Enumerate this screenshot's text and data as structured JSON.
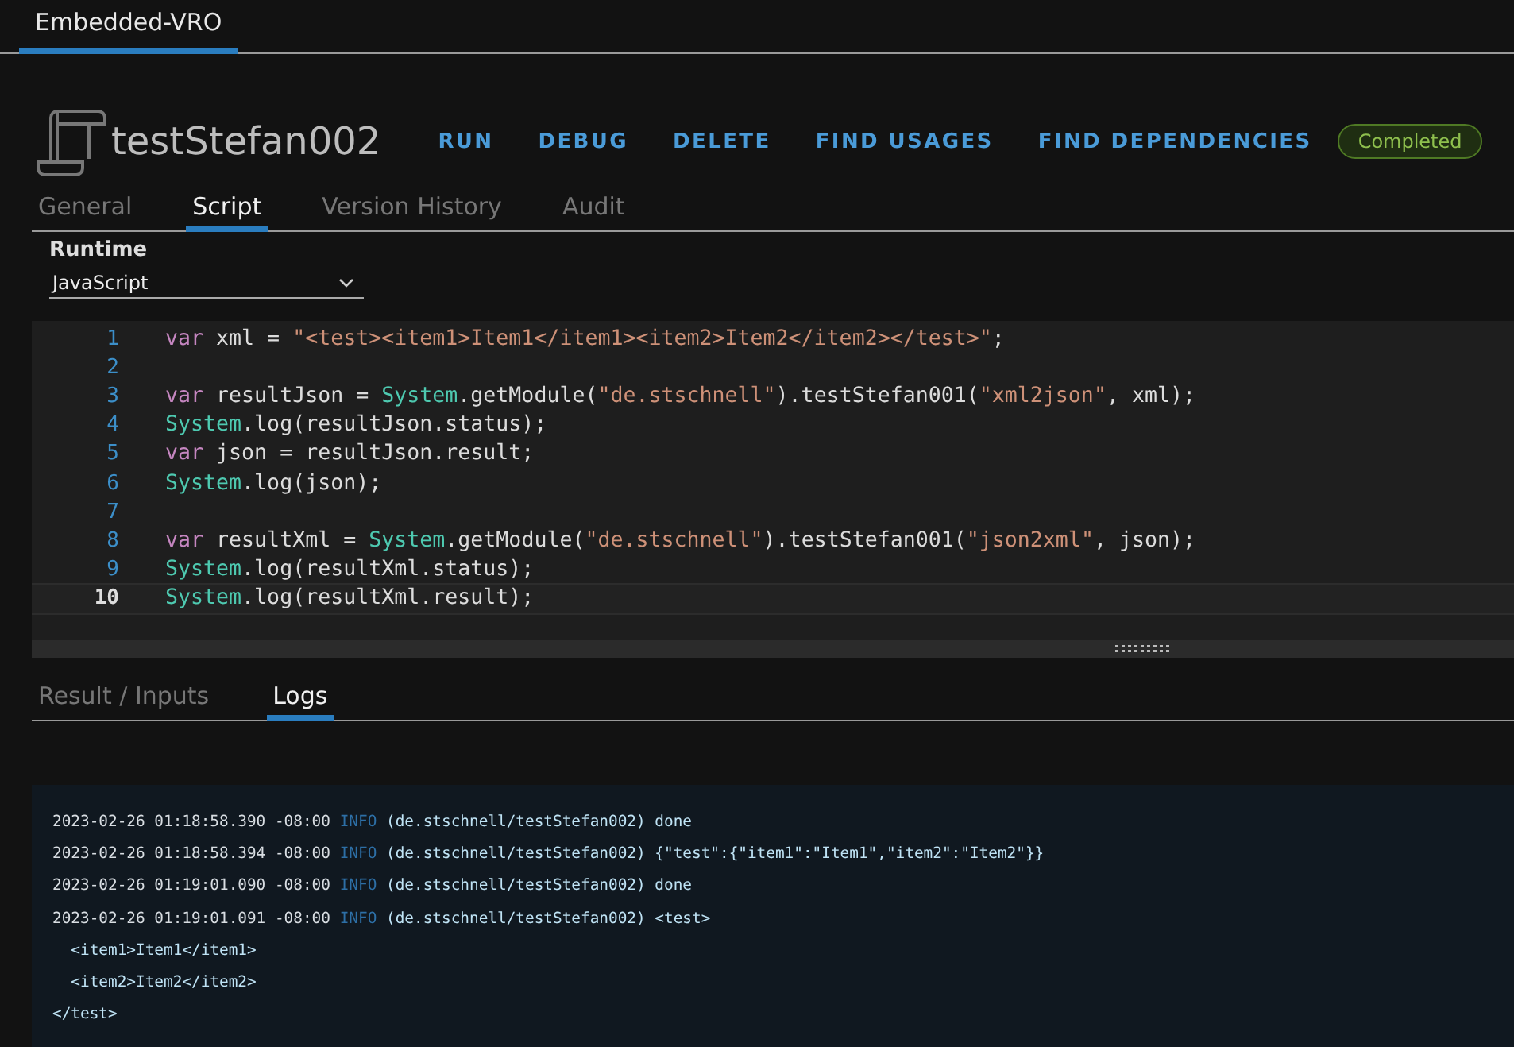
{
  "top_tabs": [
    {
      "label": "Embedded-VRO",
      "selected": true
    }
  ],
  "header": {
    "title": "testStefan002",
    "actions": [
      "RUN",
      "DEBUG",
      "DELETE",
      "FIND USAGES",
      "FIND DEPENDENCIES"
    ],
    "status": "Completed"
  },
  "tabs": [
    {
      "label": "General",
      "selected": false
    },
    {
      "label": "Script",
      "selected": true
    },
    {
      "label": "Version History",
      "selected": false
    },
    {
      "label": "Audit",
      "selected": false
    }
  ],
  "runtime": {
    "label": "Runtime",
    "value": "JavaScript"
  },
  "editor": {
    "lines": [
      {
        "number": "1",
        "current": false,
        "tokens": [
          {
            "kind": "keyword",
            "text": "var"
          },
          {
            "kind": "plain",
            "text": " xml = "
          },
          {
            "kind": "string",
            "text": "\"<test><item1>Item1</item1><item2>Item2</item2></test>\""
          },
          {
            "kind": "plain",
            "text": ";"
          }
        ]
      },
      {
        "number": "2",
        "current": false
      },
      {
        "number": "3",
        "current": false,
        "tokens": [
          {
            "kind": "keyword",
            "text": "var"
          },
          {
            "kind": "plain",
            "text": " resultJson = "
          },
          {
            "kind": "type",
            "text": "System"
          },
          {
            "kind": "plain",
            "text": ".getModule("
          },
          {
            "kind": "string",
            "text": "\"de.stschnell\""
          },
          {
            "kind": "plain",
            "text": ").testStefan001("
          },
          {
            "kind": "string",
            "text": "\"xml2json\""
          },
          {
            "kind": "plain",
            "text": ", xml);"
          }
        ]
      },
      {
        "number": "4",
        "current": false,
        "tokens": [
          {
            "kind": "type",
            "text": "System"
          },
          {
            "kind": "plain",
            "text": ".log(resultJson.status);"
          }
        ]
      },
      {
        "number": "5",
        "current": false,
        "tokens": [
          {
            "kind": "keyword",
            "text": "var"
          },
          {
            "kind": "plain",
            "text": " json = resultJson.result;"
          }
        ]
      },
      {
        "number": "6",
        "current": false,
        "tokens": [
          {
            "kind": "type",
            "text": "System"
          },
          {
            "kind": "plain",
            "text": ".log(json);"
          }
        ]
      },
      {
        "number": "7",
        "current": false
      },
      {
        "number": "8",
        "current": false,
        "tokens": [
          {
            "kind": "keyword",
            "text": "var"
          },
          {
            "kind": "plain",
            "text": " resultXml = "
          },
          {
            "kind": "type",
            "text": "System"
          },
          {
            "kind": "plain",
            "text": ".getModule("
          },
          {
            "kind": "string",
            "text": "\"de.stschnell\""
          },
          {
            "kind": "plain",
            "text": ").testStefan001("
          },
          {
            "kind": "string",
            "text": "\"json2xml\""
          },
          {
            "kind": "plain",
            "text": ", json);"
          }
        ]
      },
      {
        "number": "9",
        "current": false,
        "tokens": [
          {
            "kind": "type",
            "text": "System"
          },
          {
            "kind": "plain",
            "text": ".log(resultXml.status);"
          }
        ]
      },
      {
        "number": "10",
        "current": true,
        "tokens": [
          {
            "kind": "type",
            "text": "System"
          },
          {
            "kind": "plain",
            "text": ".log(resultXml.result);"
          }
        ]
      }
    ]
  },
  "result_tabs": [
    {
      "label": "Result / Inputs",
      "selected": false
    },
    {
      "label": "Logs",
      "selected": true
    }
  ],
  "logs": [
    {
      "timestamp": "2023-02-26 01:18:58.390 -08:00",
      "level": "INFO",
      "message": "(de.stschnell/testStefan002) done"
    },
    {
      "timestamp": "2023-02-26 01:18:58.394 -08:00",
      "level": "INFO",
      "message": "(de.stschnell/testStefan002) {\"test\":{\"item1\":\"Item1\",\"item2\":\"Item2\"}}"
    },
    {
      "timestamp": "2023-02-26 01:19:01.090 -08:00",
      "level": "INFO",
      "message": "(de.stschnell/testStefan002) done"
    },
    {
      "timestamp": "2023-02-26 01:19:01.091 -08:00",
      "level": "INFO",
      "message": "(de.stschnell/testStefan002) <test>",
      "continuation": [
        "  <item1>Item1</item1>",
        "  <item2>Item2</item2>",
        "</test>"
      ]
    }
  ]
}
